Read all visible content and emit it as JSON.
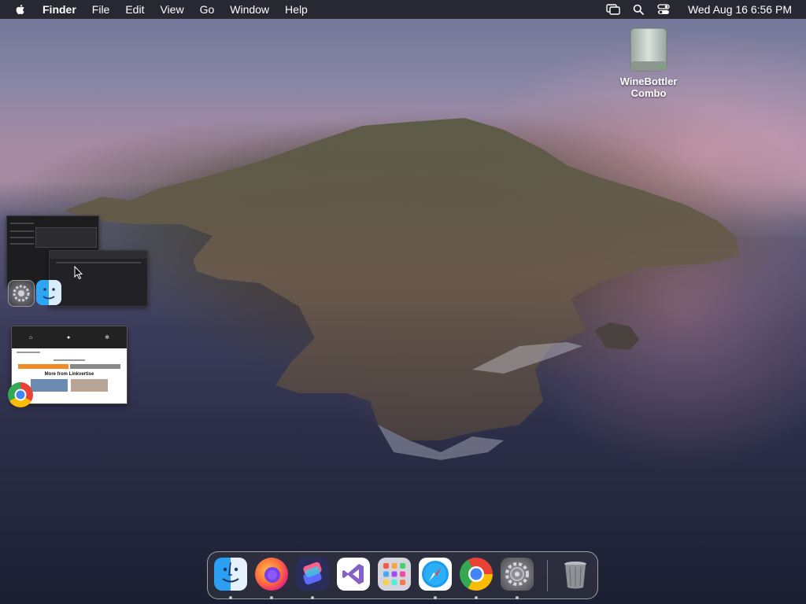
{
  "menubar": {
    "app_name": "Finder",
    "menus": [
      "File",
      "Edit",
      "View",
      "Go",
      "Window",
      "Help"
    ],
    "clock": "Wed Aug 16  6:56 PM",
    "tray_icons": [
      "screen-mirroring-icon",
      "spotlight-search-icon",
      "control-center-icon"
    ]
  },
  "desktop": {
    "drive": {
      "label_line1": "WineBottler",
      "label_line2": "Combo",
      "icon": "external-drive-icon"
    }
  },
  "stage_manager": {
    "groups": [
      {
        "apps": [
          "System Settings",
          "Finder"
        ]
      },
      {
        "apps": [
          "Google Chrome"
        ],
        "thumb_heading": "More from Linkvertise"
      }
    ]
  },
  "dock": {
    "apps": [
      {
        "name": "Finder",
        "icon": "finder-icon",
        "running": true
      },
      {
        "name": "Firefox",
        "icon": "firefox-icon",
        "running": true
      },
      {
        "name": "Shortcuts",
        "icon": "shortcuts-icon",
        "running": true
      },
      {
        "name": "Visual Studio",
        "icon": "visual-studio-icon",
        "running": false
      },
      {
        "name": "Launchpad",
        "icon": "launchpad-icon",
        "running": false
      },
      {
        "name": "Safari",
        "icon": "safari-icon",
        "running": true
      },
      {
        "name": "Google Chrome",
        "icon": "chrome-icon",
        "running": true
      },
      {
        "name": "System Settings",
        "icon": "settings-icon",
        "running": true
      }
    ],
    "trash": {
      "name": "Trash",
      "icon": "trash-icon"
    }
  },
  "colors": {
    "menubar_bg": "#1e1e24",
    "dock_border": "#ffffff"
  }
}
